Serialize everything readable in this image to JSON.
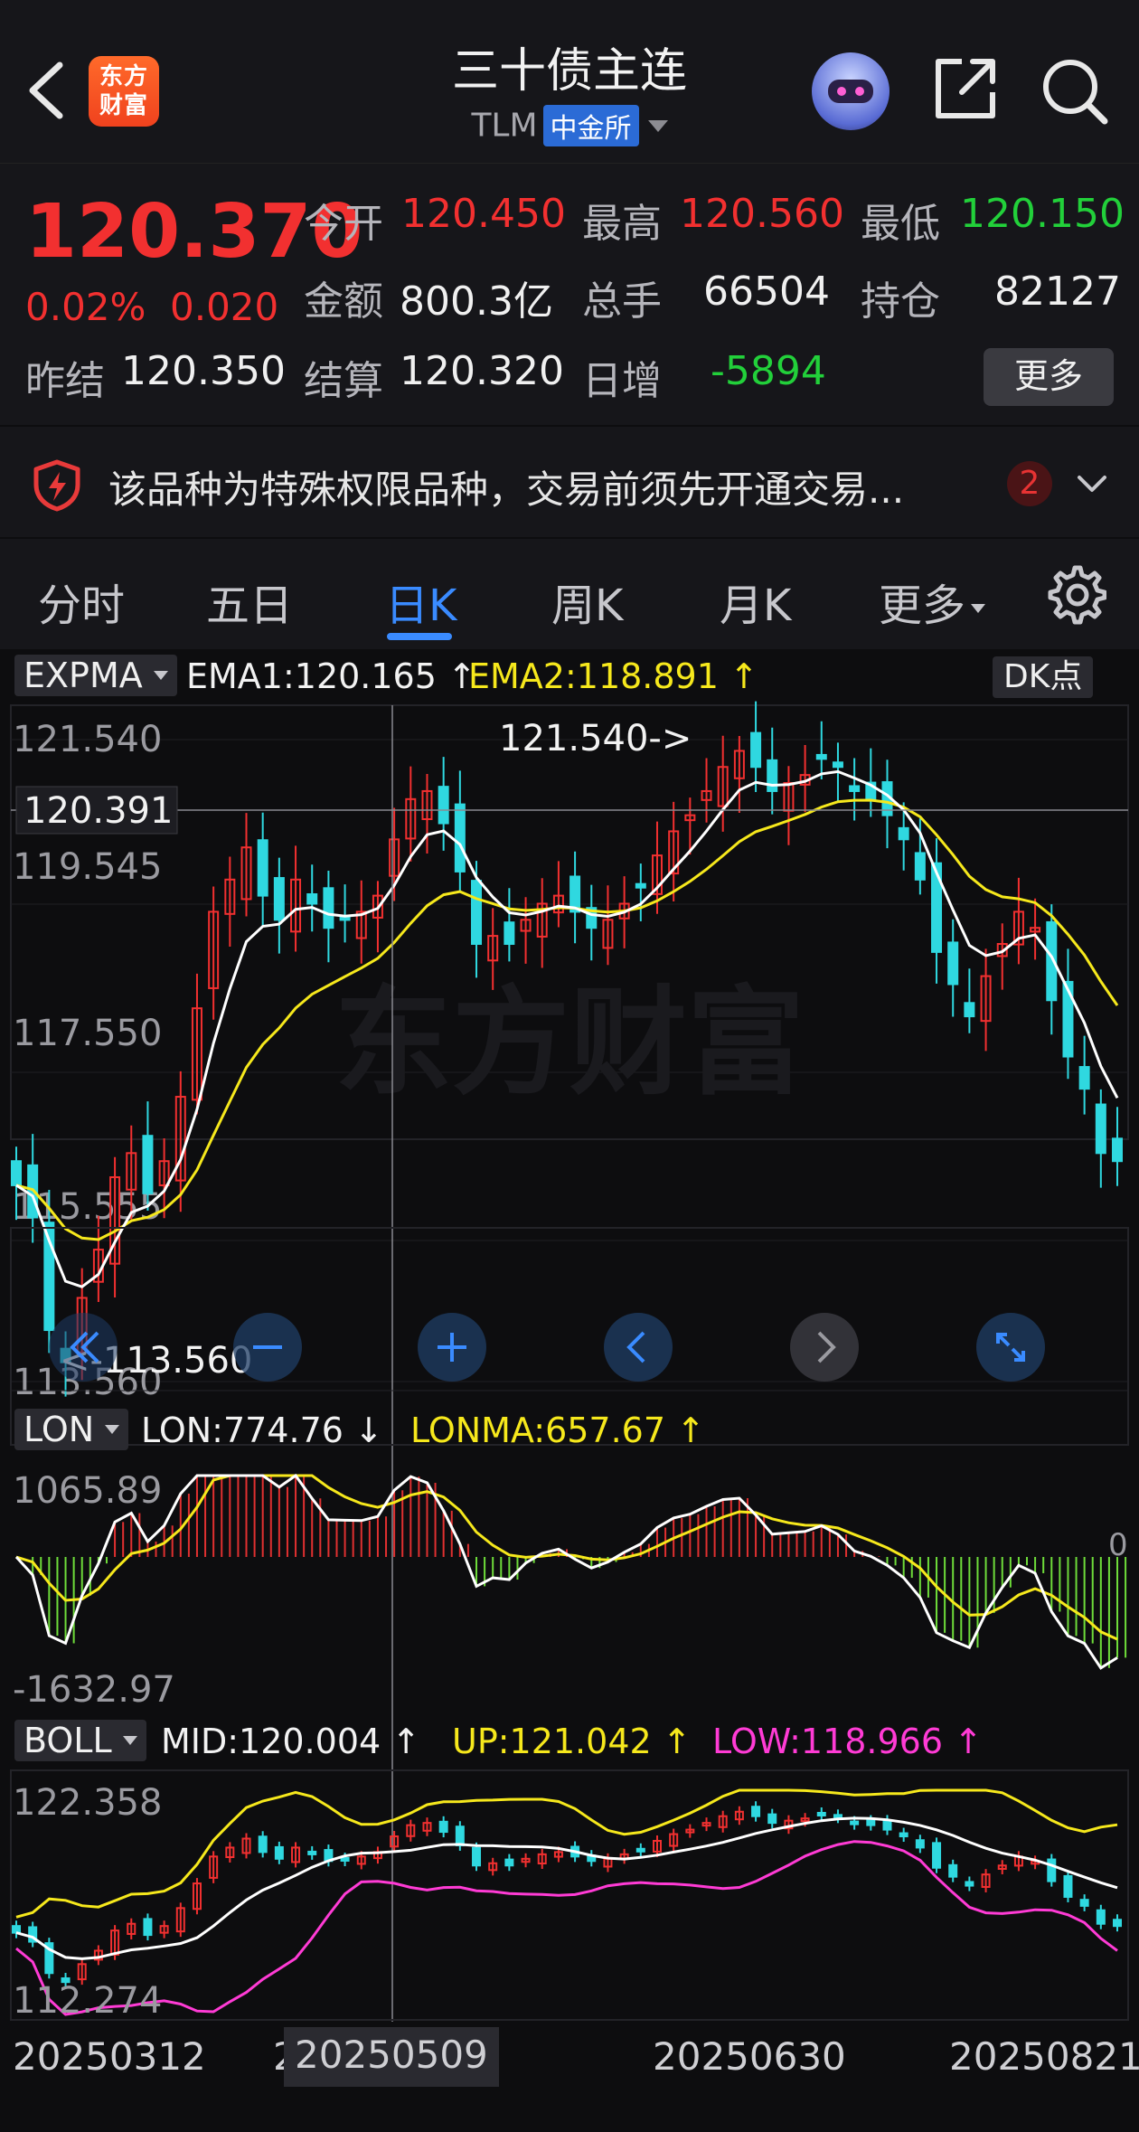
{
  "header": {
    "title": "三十债主连",
    "code": "TLM",
    "exchange": "中金所",
    "logo_line1": "东方",
    "logo_line2": "财富"
  },
  "quote": {
    "last_price": "120.370",
    "pct_change": "0.02%",
    "abs_change": "0.020",
    "open_label": "今开",
    "open": "120.450",
    "high_label": "最高",
    "high": "120.560",
    "low_label": "最低",
    "low": "120.150",
    "amount_label": "金额",
    "amount": "800.3亿",
    "volume_label": "总手",
    "volume": "66504",
    "oi_label": "持仓",
    "oi": "82127",
    "prev_settle_label": "昨结",
    "prev_settle": "120.350",
    "settle_label": "结算",
    "settle": "120.320",
    "daily_inc_label": "日增",
    "daily_inc": "-5894",
    "more_label": "更多",
    "price_color_up": "#f23030",
    "price_color_down": "#22d03a"
  },
  "notice": {
    "text": "该品种为特殊权限品种，交易前须先开通交易...",
    "count": "2"
  },
  "tabs": [
    {
      "label": "分时"
    },
    {
      "label": "五日"
    },
    {
      "label": "日K"
    },
    {
      "label": "周K"
    },
    {
      "label": "月K"
    },
    {
      "label": "更多"
    }
  ],
  "active_tab": "日K",
  "main_indicator": {
    "name": "EXPMA",
    "ema1": "EMA1:120.165",
    "ema1_arrow": "↑",
    "ema2": "EMA2:118.891",
    "ema2_arrow": "↑",
    "dk_label": "DK点",
    "y_labels": [
      "121.540",
      "119.545",
      "117.550",
      "115.555",
      "113.560"
    ],
    "crosshair_price": "120.391",
    "max_marker": "121.540->",
    "min_marker": "<-113.560",
    "watermark": "东方财富"
  },
  "lon_indicator": {
    "name": "LON",
    "lon": "LON:774.76",
    "lon_arrow": "↓",
    "lonma": "LONMA:657.67",
    "lonma_arrow": "↑",
    "y_top": "1065.89",
    "y_bottom": "-1632.97",
    "zero": "0"
  },
  "boll_indicator": {
    "name": "BOLL",
    "mid": "MID:120.004",
    "mid_arrow": "↑",
    "up": "UP:121.042",
    "up_arrow": "↑",
    "low": "LOW:118.966",
    "low_arrow": "↑",
    "y_top": "122.358",
    "y_bottom": "112.274"
  },
  "dates": {
    "d1": "20250312",
    "d2_partial": "2",
    "crosshair": "20250509",
    "d3": "20250630",
    "d4": "20250821"
  },
  "colors": {
    "up": "#f23030",
    "down": "#2fd8e0",
    "ema1": "#ffffff",
    "ema2": "#f6e81c",
    "lon_pos": "#e03030",
    "lon_neg": "#6edc3a",
    "boll_low": "#ff3bd5",
    "accent": "#3a8bff"
  },
  "chart_data": {
    "type": "candlestick",
    "ylim": [
      113.56,
      121.54
    ],
    "close_series": [
      116.0,
      115.6,
      114.2,
      113.8,
      114.6,
      115.2,
      116.1,
      116.4,
      115.9,
      116.3,
      117.1,
      118.2,
      119.4,
      119.8,
      120.2,
      119.6,
      119.3,
      119.8,
      119.5,
      119.2,
      119.3,
      119.4,
      119.6,
      120.3,
      120.8,
      120.9,
      120.5,
      119.9,
      119.0,
      119.1,
      119.0,
      119.3,
      119.5,
      119.6,
      119.4,
      119.2,
      119.3,
      119.5,
      119.7,
      120.1,
      120.4,
      120.6,
      120.9,
      121.2,
      121.4,
      121.2,
      120.9,
      121.0,
      121.1,
      121.3,
      121.2,
      120.9,
      120.8,
      120.6,
      120.3,
      119.8,
      118.9,
      118.5,
      118.1,
      118.6,
      119.0,
      119.4,
      119.2,
      118.3,
      117.6,
      117.2,
      116.4,
      116.3
    ]
  }
}
